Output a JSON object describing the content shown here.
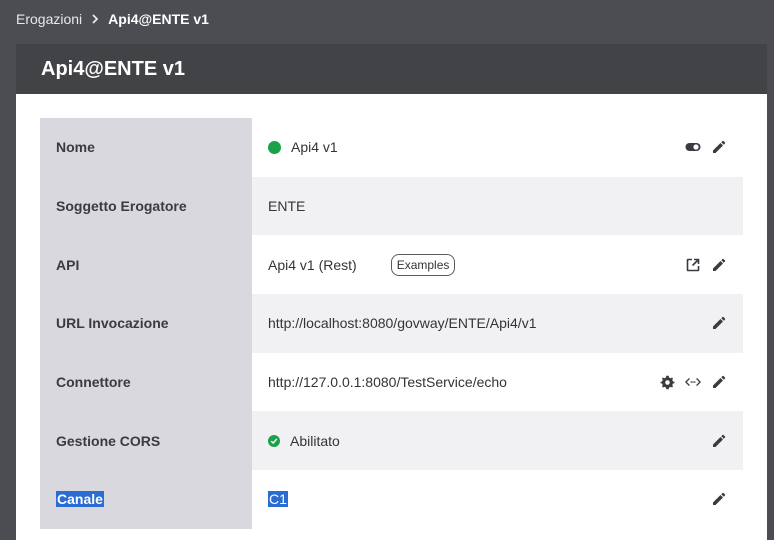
{
  "breadcrumb": {
    "parent": "Erogazioni",
    "current": "Api4@ENTE v1"
  },
  "header": {
    "title": "Api4@ENTE v1"
  },
  "rows": [
    {
      "label": "Nome",
      "value": "Api4 v1",
      "status_color": "#1aa24a",
      "actions": [
        "toggle-icon",
        "edit-icon"
      ]
    },
    {
      "label": "Soggetto Erogatore",
      "value": "ENTE",
      "actions": []
    },
    {
      "label": "API",
      "value": "Api4 v1 (Rest)",
      "badge": "Examples",
      "actions": [
        "open-external-icon",
        "edit-icon"
      ]
    },
    {
      "label": "URL Invocazione",
      "value": "http://localhost:8080/govway/ENTE/Api4/v1",
      "actions": [
        "edit-icon"
      ]
    },
    {
      "label": "Connettore",
      "value": "http://127.0.0.1:8080/TestService/echo",
      "actions": [
        "gear-icon",
        "code-icon",
        "edit-icon"
      ]
    },
    {
      "label": "Gestione CORS",
      "value": "Abilitato",
      "status_color": "#1aa24a",
      "actions": [
        "edit-icon"
      ]
    },
    {
      "label": "Canale",
      "value": "C1",
      "selected": true,
      "actions": [
        "edit-icon"
      ]
    }
  ],
  "colors": {
    "background": "#4b4d52",
    "header": "#424347",
    "label_bg": "#d8d8de",
    "alt_row": "#f1f1f3",
    "success": "#1aa24a",
    "selection": "#2a6bd4"
  }
}
